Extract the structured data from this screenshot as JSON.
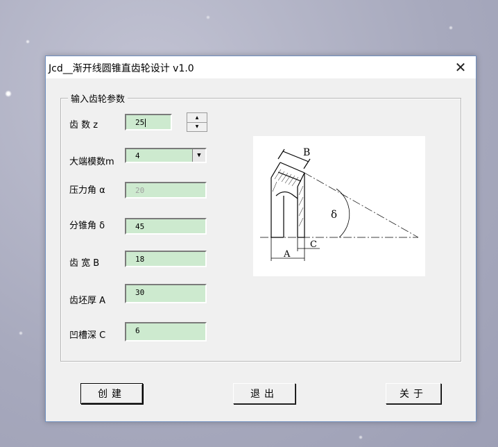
{
  "window": {
    "title": "Jcd__渐开线圆锥直齿轮设计 v1.0",
    "close_symbol": "✕"
  },
  "group": {
    "legend": "输入齿轮参数"
  },
  "params": {
    "teeth": {
      "label": "齿  数 z",
      "value": "25"
    },
    "module": {
      "label": "大端模数m",
      "value": "4"
    },
    "pressure_angle": {
      "label": "压力角 α",
      "value": "20"
    },
    "cone_angle": {
      "label": "分锥角 δ",
      "value": "45"
    },
    "face_width": {
      "label": "齿  宽 B",
      "value": "18"
    },
    "blank_thickness": {
      "label": "齿坯厚 A",
      "value": "30"
    },
    "groove_depth": {
      "label": "凹槽深 C",
      "value": "6"
    }
  },
  "spinner": {
    "up": "▲",
    "down": "▼"
  },
  "dropdown_arrow": "▼",
  "diagram": {
    "label_b": "B",
    "label_delta": "δ",
    "label_a": "A",
    "label_c": "C"
  },
  "buttons": {
    "create": "创建",
    "exit": "退出",
    "about": "关于"
  },
  "colors": {
    "field_bg": "#cdeacf",
    "window_bg": "#f0f0f0",
    "window_border": "#6f8fbf"
  },
  "icons": {
    "close": "close-icon",
    "spin_up": "arrow-up-icon",
    "spin_down": "arrow-down-icon",
    "dropdown": "chevron-down-icon"
  }
}
